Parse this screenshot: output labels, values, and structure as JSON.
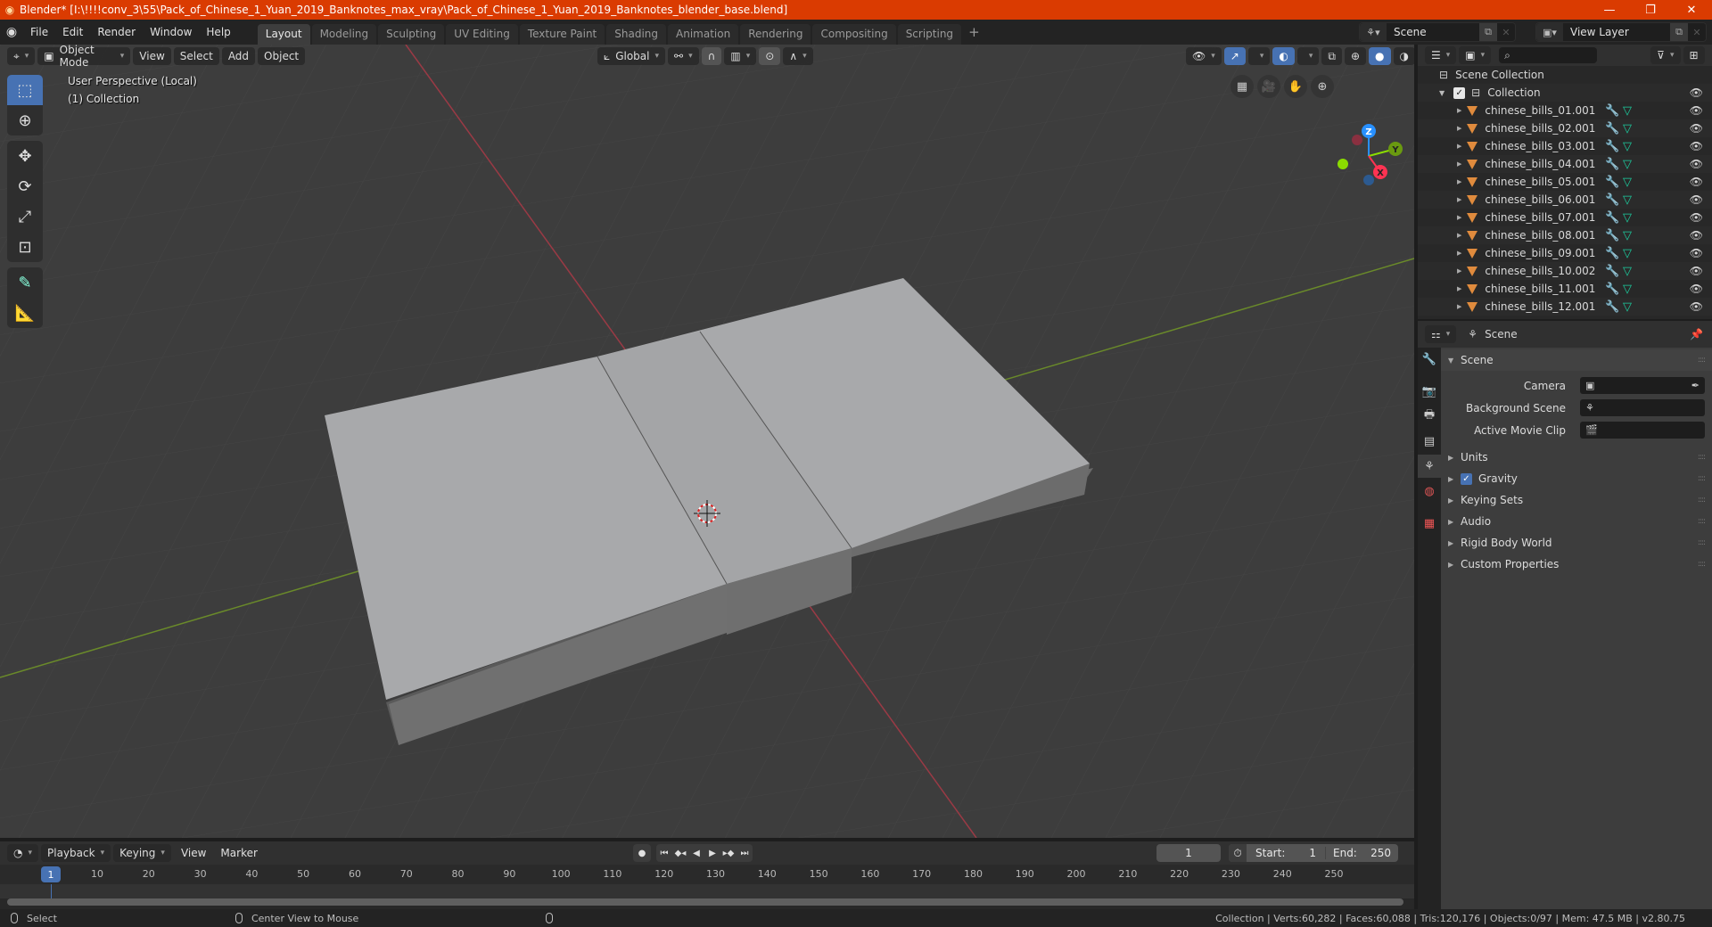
{
  "window": {
    "title": "Blender* [I:\\!!!!conv_3\\55\\Pack_of_Chinese_1_Yuan_2019_Banknotes_max_vray\\Pack_of_Chinese_1_Yuan_2019_Banknotes_blender_base.blend]",
    "controls": {
      "minimize": "—",
      "maximize": "❐",
      "close": "✕"
    }
  },
  "menu": [
    "File",
    "Edit",
    "Render",
    "Window",
    "Help"
  ],
  "workspaces": {
    "tabs": [
      "Layout",
      "Modeling",
      "Sculpting",
      "UV Editing",
      "Texture Paint",
      "Shading",
      "Animation",
      "Rendering",
      "Compositing",
      "Scripting"
    ],
    "active": "Layout",
    "add_label": "+"
  },
  "scene_selector": {
    "value": "Scene"
  },
  "view_layer_selector": {
    "value": "View Layer"
  },
  "viewport": {
    "mode": "Object Mode",
    "menus": [
      "View",
      "Select",
      "Add",
      "Object"
    ],
    "orientation": "Global",
    "overlay_line1": "User Perspective (Local)",
    "overlay_line2": "(1) Collection",
    "gizmo": {
      "x": "X",
      "y": "Y",
      "z": "Z",
      "x_color": "#ff3352",
      "y_color": "#8bdc00",
      "z_color": "#2890ff"
    },
    "tools": [
      "select-box",
      "cursor",
      "move",
      "rotate",
      "scale",
      "transform",
      "annotate",
      "measure"
    ],
    "shading_active": "solid"
  },
  "outliner": {
    "root": "Scene Collection",
    "collection": "Collection",
    "objects": [
      "chinese_bills_01.001",
      "chinese_bills_02.001",
      "chinese_bills_03.001",
      "chinese_bills_04.001",
      "chinese_bills_05.001",
      "chinese_bills_06.001",
      "chinese_bills_07.001",
      "chinese_bills_08.001",
      "chinese_bills_09.001",
      "chinese_bills_10.002",
      "chinese_bills_11.001",
      "chinese_bills_12.001"
    ]
  },
  "properties": {
    "context": "Scene",
    "panel_title": "Scene",
    "fields": [
      {
        "label": "Camera",
        "value": ""
      },
      {
        "label": "Background Scene",
        "value": ""
      },
      {
        "label": "Active Movie Clip",
        "value": ""
      }
    ],
    "subpanels": [
      {
        "label": "Units",
        "checkbox": false
      },
      {
        "label": "Gravity",
        "checkbox": true,
        "checked": true
      },
      {
        "label": "Keying Sets",
        "checkbox": false
      },
      {
        "label": "Audio",
        "checkbox": false
      },
      {
        "label": "Rigid Body World",
        "checkbox": false
      },
      {
        "label": "Custom Properties",
        "checkbox": false
      }
    ]
  },
  "timeline": {
    "menus": [
      "Playback",
      "Keying",
      "View",
      "Marker"
    ],
    "current_frame": "1",
    "start_label": "Start:",
    "start": "1",
    "end_label": "End:",
    "end": "250",
    "ticks": [
      "10",
      "20",
      "30",
      "40",
      "50",
      "60",
      "70",
      "80",
      "90",
      "100",
      "110",
      "120",
      "130",
      "140",
      "150",
      "160",
      "170",
      "180",
      "190",
      "200",
      "210",
      "220",
      "230",
      "240",
      "250"
    ]
  },
  "statusbar": {
    "left_action": "Select",
    "middle_action": "Center View to Mouse",
    "stats": "Collection | Verts:60,282 | Faces:60,088 | Tris:120,176 | Objects:0/97 | Mem: 47.5 MB | v2.80.75"
  }
}
